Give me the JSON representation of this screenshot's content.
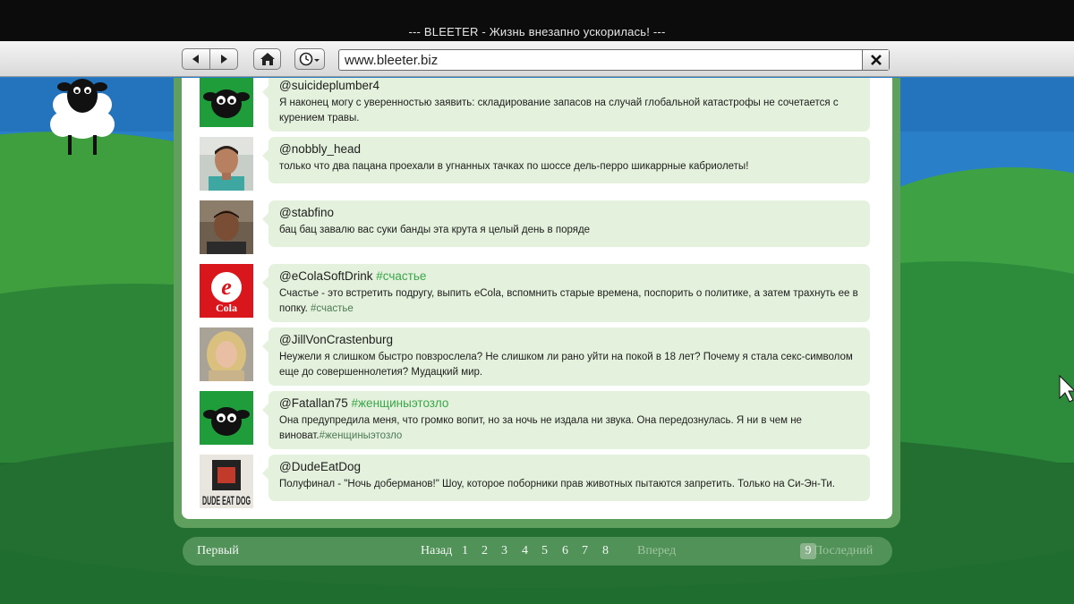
{
  "window": {
    "title": "--- BLEETER - Жизнь внезапно ускорилась! ---"
  },
  "toolbar": {
    "url": "www.bleeter.biz",
    "icons": [
      "back-arrow-icon",
      "forward-arrow-icon",
      "home-icon",
      "clock-icon",
      "close-icon"
    ]
  },
  "colors": {
    "accent_green": "#3aa64a",
    "bubble": "#e4f1dc",
    "sky": "#2a7fc9"
  },
  "posts": [
    {
      "handle": "@suicideplumber4",
      "tag": "",
      "text": "Я наконец могу с уверенностью заявить: складирование запасов на случай глобальной катастрофы не сочетается с курением травы.",
      "text_tag": "",
      "avatar": "sheep-avatar"
    },
    {
      "handle": "@nobbly_head",
      "tag": "",
      "text": "только что два пацана проехали в угнанных тачках по шоссе дель-перро шикаррные кабриолеты!",
      "text_tag": "",
      "avatar": "man-photo-avatar"
    },
    {
      "handle": "@stabfino",
      "tag": "",
      "text": "бац бац завалю вас суки банды эта крута я целый день в поряде",
      "text_tag": "",
      "avatar": "man-photo-avatar"
    },
    {
      "handle": "@eColaSoftDrink",
      "tag": "#счастье",
      "text": "Счастье - это встретить подругу, выпить eCola, вспомнить старые времена, поспорить о политике, а затем трахнуть ее в попку.",
      "text_tag": "#счастье",
      "avatar": "ecola-logo-avatar"
    },
    {
      "handle": "@JillVonCrastenburg",
      "tag": "",
      "text": "Неужели я слишком быстро повзрослела? Не слишком ли рано уйти на покой в 18 лет? Почему я стала секс-символом еще до совершеннолетия? Мудацкий мир.",
      "text_tag": "",
      "avatar": "woman-photo-avatar"
    },
    {
      "handle": "@Fatallan75",
      "tag": "#женщиныэтозло",
      "text": "Она предупредила меня, что громко вопит, но за ночь не издала ни звука. Она передознулась. Я ни в чем не виноват.",
      "text_tag": "#женщиныэтозло",
      "avatar": "sheep-avatar"
    },
    {
      "handle": "@DudeEatDog",
      "tag": "",
      "text": "Полуфинал - \"Ночь доберманов!\" Шоу, которое поборники прав животных пытаются запретить. Только на Си-Эн-Ти.",
      "text_tag": "",
      "avatar": "dude-eat-dog-logo-avatar"
    }
  ],
  "avatar_logos": {
    "ecola": "Cola",
    "dude_eat_dog": "DUDE EAT DOG"
  },
  "pager": {
    "first": "Первый",
    "prev": "Назад",
    "pages": [
      "1",
      "2",
      "3",
      "4",
      "5",
      "6",
      "7",
      "8"
    ],
    "current": "9",
    "next": "Вперед",
    "last": "Последний"
  }
}
